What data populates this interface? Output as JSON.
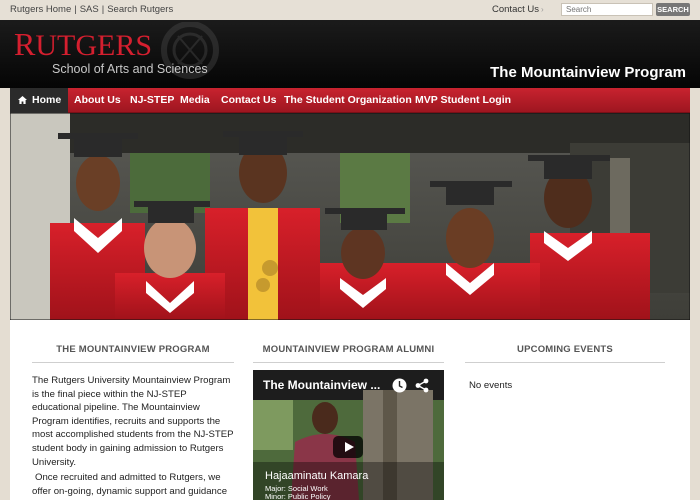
{
  "topbar": {
    "links": [
      "Rutgers Home",
      "SAS",
      "Search Rutgers"
    ],
    "contact": "Contact Us",
    "search_placeholder": "Search",
    "search_button": "SEARCH"
  },
  "header": {
    "logo_text": "Rutgers",
    "logo_initial": "R",
    "logo_rest": "UTGERS",
    "school": "School of Arts and Sciences",
    "program": "The Mountainview Program"
  },
  "nav": {
    "items": [
      "Home",
      "About Us",
      "NJ-STEP",
      "Media",
      "Contact Us",
      "The Student Organization",
      "MVP Student Login"
    ],
    "active": "Home"
  },
  "hero": {
    "icon": "graduates-photo"
  },
  "columns": {
    "program": {
      "title": "THE MOUNTAINVIEW PROGRAM",
      "paragraph1": "The Rutgers University Mountainview Program is the final piece within the NJ-STEP educational pipeline. The Mountainview Program identifies, recruits and supports the most accomplished students from the NJ-STEP student body in gaining admission to Rutgers University.",
      "paragraph2": "Once recruited and admitted to Rutgers, we offer on-going, dynamic support and guidance in earning a Rutgers degree while"
    },
    "alumni": {
      "title": "MOUNTAINVIEW PROGRAM ALUMNI",
      "video_title": "The Mountainview ...",
      "person_name": "Hajaaminatu Kamara",
      "person_major": "Major: Social Work",
      "person_minor": "Minor: Public Policy"
    },
    "events": {
      "title": "UPCOMING EVENTS",
      "empty": "No events"
    }
  },
  "colors": {
    "brand_red": "#cc2232",
    "nav_dark": "#2b2b2b",
    "header_black": "#0c0c0c",
    "page_bg": "#e4ddd2"
  }
}
